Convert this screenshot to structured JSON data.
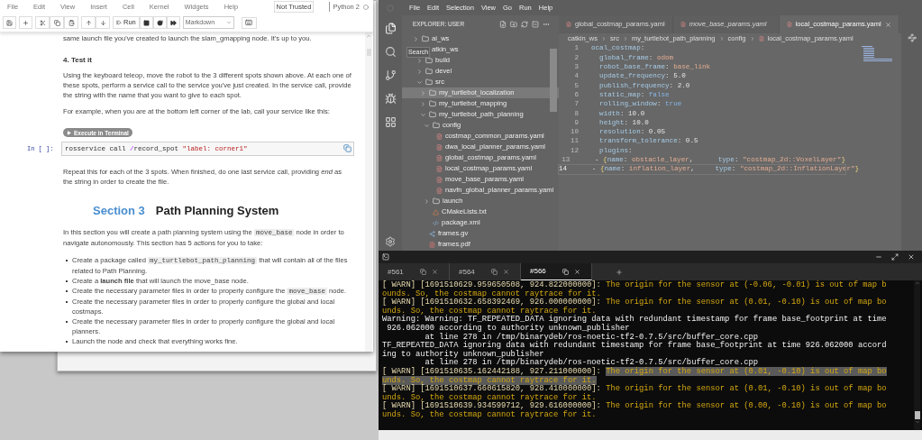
{
  "notebook": {
    "menu": [
      "File",
      "Edit",
      "View",
      "Insert",
      "Cell",
      "Kernel",
      "Widgets",
      "Help"
    ],
    "trust_badge": "Not Trusted",
    "kernel_name": "Python 2",
    "toolbar": {
      "run_label": "Run",
      "cell_type": "Markdown"
    },
    "cells": [
      {
        "kind": "paragraph",
        "segments": [
          {
            "t": "same launch file you've created to launch the slam_gmapping node. It's up to you."
          }
        ]
      },
      {
        "kind": "heading",
        "text": "4. Test it"
      },
      {
        "kind": "paragraph",
        "segments": [
          {
            "t": "Using the keyboard teleop, move the robot to the 3 different spots shown above. At each one of these spots, perform a service call to the service you've just created. In the service call, provide the string with the name that you want to give to each spot."
          }
        ]
      },
      {
        "kind": "paragraph",
        "segments": [
          {
            "t": "For example, when you are at the bottom left corner of the lab, call your service like this:"
          }
        ]
      },
      {
        "kind": "run_button",
        "text": "Execute in Terminal"
      },
      {
        "kind": "code",
        "prompt": "In [ ]:",
        "tokens": [
          {
            "t": "rosservice call ",
            "kind": "plain"
          },
          {
            "t": "/",
            "kind": "op"
          },
          {
            "t": "record_spot ",
            "kind": "plain"
          },
          {
            "t": "\"label: corner1\"",
            "kind": "str"
          }
        ]
      },
      {
        "kind": "paragraph",
        "segments": [
          {
            "t": "Repeat this for each of the 3 spots. When finished, do one last service call, providing *end* as the string in order to create the file."
          }
        ]
      },
      {
        "kind": "section",
        "number": "Section 3",
        "title": "Path Planning System"
      },
      {
        "kind": "paragraph",
        "segments": [
          {
            "t": "In this section you will create a path planning system using the "
          },
          {
            "t": "move_base",
            "kind": "code"
          },
          {
            "t": " node in order to navigate autonomously. This section has 5 actions for you to take:"
          }
        ]
      },
      {
        "kind": "list",
        "items": [
          [
            {
              "t": "Create a package called "
            },
            {
              "t": "my_turtlebot_path_planning",
              "kind": "code"
            },
            {
              "t": " that will contain all of the files related to Path Planning."
            }
          ],
          [
            {
              "t": "Create a **launch file** that will launch the move_base node."
            }
          ],
          [
            {
              "t": "Create the necessary parameter files in order to properly configure the "
            },
            {
              "t": "move_base",
              "kind": "code"
            },
            {
              "t": " node."
            }
          ],
          [
            {
              "t": "Create the necessary parameter files in order to properly configure the global and local costmaps."
            }
          ],
          [
            {
              "t": "Create the necessary parameter files in order to properly configure the global and local planners."
            }
          ],
          [
            {
              "t": "Launch the node and check that everything works fine."
            }
          ]
        ]
      }
    ]
  },
  "vscode": {
    "menu": [
      "File",
      "Edit",
      "Selection",
      "View",
      "Go",
      "Run",
      "Help"
    ],
    "explorer_title": "EXPLORER: USER",
    "tooltip": "Search",
    "tree": [
      {
        "label": "ai_ws",
        "kind": "folder",
        "expanded": false,
        "selected": false
      },
      {
        "label": "atkin_ws",
        "kind": "folder",
        "expanded": true,
        "selected": false,
        "covered": true,
        "children": [
          {
            "label": "build",
            "kind": "folder",
            "expanded": false,
            "selected": false
          },
          {
            "label": "devel",
            "kind": "folder",
            "expanded": false,
            "selected": false
          },
          {
            "label": "src",
            "kind": "folder",
            "expanded": true,
            "selected": false,
            "children": [
              {
                "label": "my_turtlebot_localization",
                "kind": "folder",
                "expanded": false,
                "selected": true
              },
              {
                "label": "my_turtlebot_mapping",
                "kind": "folder",
                "expanded": false,
                "selected": false
              },
              {
                "label": "my_turtlebot_path_planning",
                "kind": "folder",
                "expanded": true,
                "selected": false,
                "children": [
                  {
                    "label": "config",
                    "kind": "folder",
                    "expanded": true,
                    "selected": false,
                    "children": [
                      {
                        "label": "costmap_common_params.yaml",
                        "kind": "yaml",
                        "selected": false
                      },
                      {
                        "label": "dwa_local_planner_params.yaml",
                        "kind": "yaml",
                        "selected": false
                      },
                      {
                        "label": "global_costmap_params.yaml",
                        "kind": "yaml",
                        "selected": false
                      },
                      {
                        "label": "local_costmap_params.yaml",
                        "kind": "yaml",
                        "selected": false
                      },
                      {
                        "label": "move_base_params.yaml",
                        "kind": "yaml",
                        "selected": false
                      },
                      {
                        "label": "navfn_global_planner_params.yaml",
                        "kind": "yaml",
                        "selected": false
                      }
                    ]
                  },
                  {
                    "label": "launch",
                    "kind": "folder",
                    "expanded": false,
                    "selected": false
                  },
                  {
                    "label": "CMakeLists.txt",
                    "kind": "cmake",
                    "selected": false
                  },
                  {
                    "label": "package.xml",
                    "kind": "xml",
                    "selected": false
                  }
                ]
              },
              {
                "label": "frames.gv",
                "kind": "graph",
                "selected": false
              },
              {
                "label": "frames.pdf",
                "kind": "pdf",
                "selected": false
              }
            ]
          }
        ]
      }
    ],
    "tabs": [
      {
        "label": "global_costmap_params.yaml",
        "selected": false,
        "preview": false
      },
      {
        "label": "move_base_params.yaml",
        "selected": false,
        "preview": true
      },
      {
        "label": "local_costmap_params.yaml",
        "selected": true,
        "preview": false
      }
    ],
    "breadcrumbs": [
      "catkin_ws",
      "src",
      "my_turtlebot_path_planning",
      "config",
      "local_costmap_params.yaml"
    ],
    "code_lines": [
      {
        "number": "1",
        "current": false,
        "tokens": [
          {
            "t": "ocal_costmap",
            "kind": "key"
          },
          {
            "t": ":",
            "kind": "punct"
          }
        ]
      },
      {
        "number": "2",
        "current": false,
        "tokens": [
          {
            "t": "  global_frame",
            "kind": "key"
          },
          {
            "t": ": ",
            "kind": "punct"
          },
          {
            "t": "odom",
            "kind": "str"
          }
        ]
      },
      {
        "number": "3",
        "current": false,
        "tokens": [
          {
            "t": "  robot_base_frame",
            "kind": "key"
          },
          {
            "t": ": ",
            "kind": "punct"
          },
          {
            "t": "base_link",
            "kind": "str"
          }
        ]
      },
      {
        "number": "4",
        "current": false,
        "tokens": [
          {
            "t": "  update_frequency",
            "kind": "key"
          },
          {
            "t": ": ",
            "kind": "punct"
          },
          {
            "t": "5.0",
            "kind": "num"
          }
        ]
      },
      {
        "number": "5",
        "current": false,
        "tokens": [
          {
            "t": "  publish_frequency",
            "kind": "key"
          },
          {
            "t": ": ",
            "kind": "punct"
          },
          {
            "t": "2.0",
            "kind": "num"
          }
        ]
      },
      {
        "number": "6",
        "current": false,
        "tokens": [
          {
            "t": "  static_map",
            "kind": "key"
          },
          {
            "t": ": ",
            "kind": "punct"
          },
          {
            "t": "false",
            "kind": "bool"
          }
        ]
      },
      {
        "number": "7",
        "current": false,
        "tokens": [
          {
            "t": "  rolling_window",
            "kind": "key"
          },
          {
            "t": ": ",
            "kind": "punct"
          },
          {
            "t": "true",
            "kind": "bool"
          }
        ]
      },
      {
        "number": "8",
        "current": false,
        "tokens": [
          {
            "t": "  width",
            "kind": "key"
          },
          {
            "t": ": ",
            "kind": "punct"
          },
          {
            "t": "10.0",
            "kind": "num"
          }
        ]
      },
      {
        "number": "9",
        "current": false,
        "tokens": [
          {
            "t": "  height",
            "kind": "key"
          },
          {
            "t": ": ",
            "kind": "punct"
          },
          {
            "t": "10.0",
            "kind": "num"
          }
        ]
      },
      {
        "number": "10",
        "current": false,
        "tokens": [
          {
            "t": "  resolution",
            "kind": "key"
          },
          {
            "t": ": ",
            "kind": "punct"
          },
          {
            "t": "0.05",
            "kind": "num"
          }
        ]
      },
      {
        "number": "11",
        "current": false,
        "tokens": [
          {
            "t": "  transform_tolerance",
            "kind": "key"
          },
          {
            "t": ": ",
            "kind": "punct"
          },
          {
            "t": "0.5",
            "kind": "num"
          }
        ]
      },
      {
        "number": "12",
        "current": false,
        "tokens": [
          {
            "t": "  plugins",
            "kind": "key"
          },
          {
            "t": ":",
            "kind": "punct"
          }
        ]
      },
      {
        "number": "13",
        "current": false,
        "tokens": [
          {
            "t": "   - ",
            "kind": "punct"
          },
          {
            "t": "{",
            "kind": "brace"
          },
          {
            "t": "name",
            "kind": "key"
          },
          {
            "t": ": ",
            "kind": "punct"
          },
          {
            "t": "obstacle_layer",
            "kind": "str"
          },
          {
            "t": ",      ",
            "kind": "punct"
          },
          {
            "t": "type",
            "kind": "key"
          },
          {
            "t": ": ",
            "kind": "punct"
          },
          {
            "t": "\"costmap_2d::VoxelLayer\"",
            "kind": "str"
          },
          {
            "t": "}",
            "kind": "brace"
          }
        ]
      },
      {
        "number": "14",
        "current": true,
        "tokens": [
          {
            "t": "   - ",
            "kind": "punct"
          },
          {
            "t": "{",
            "kind": "brace"
          },
          {
            "t": "name",
            "kind": "key"
          },
          {
            "t": ": ",
            "kind": "punct"
          },
          {
            "t": "inflation_layer",
            "kind": "str"
          },
          {
            "t": ",     ",
            "kind": "punct"
          },
          {
            "t": "type",
            "kind": "key"
          },
          {
            "t": ": ",
            "kind": "punct"
          },
          {
            "t": "\"costmap_2d::InflationLayer\"",
            "kind": "str"
          },
          {
            "t": "}",
            "kind": "brace"
          }
        ]
      }
    ]
  },
  "terminal": {
    "tabs": [
      {
        "label": "#561",
        "selected": false
      },
      {
        "label": "#564",
        "selected": false
      },
      {
        "label": "#566",
        "selected": true
      }
    ],
    "lines": [
      {
        "kind": "warn",
        "highlighted": false,
        "prefix": "[ WARN] [1691510629.959650508, 924.822000000]: ",
        "text": "The origin for the sensor at (-0.06, -0.01) is out of map b"
      },
      {
        "kind": "warn",
        "highlighted": false,
        "text": "ounds. So, the costmap cannot raytrace for it."
      },
      {
        "kind": "warn",
        "highlighted": false,
        "prefix": "[ WARN] [1691510632.658392469, 926.000000000]: ",
        "text": "The origin for the sensor at (0.01, -0.10) is out of map bo"
      },
      {
        "kind": "warn",
        "highlighted": false,
        "text": "unds. So, the costmap cannot raytrace for it."
      },
      {
        "kind": "plain",
        "highlighted": false,
        "text": "Warning: Warning: TF_REPEATED_DATA ignoring data with redundant timestamp for frame base_footprint at time"
      },
      {
        "kind": "plain",
        "highlighted": false,
        "text": " 926.062000 according to authority unknown_publisher"
      },
      {
        "kind": "plain",
        "highlighted": false,
        "text": "         at line 278 in /tmp/binarydeb/ros-noetic-tf2-0.7.5/src/buffer_core.cpp"
      },
      {
        "kind": "plain",
        "highlighted": false,
        "text": "TF_REPEATED_DATA ignoring data with redundant timestamp for frame base_footprint at time 926.062000 accord"
      },
      {
        "kind": "plain",
        "highlighted": false,
        "text": "ing to authority unknown_publisher"
      },
      {
        "kind": "plain",
        "highlighted": false,
        "text": "         at line 278 in /tmp/binarydeb/ros-noetic-tf2-0.7.5/src/buffer_core.cpp"
      },
      {
        "kind": "warn",
        "highlighted": true,
        "prefix": "[ WARN] [1691510635.162442188, 927.211000000]: ",
        "text": "The origin for the sensor at (0.01, -0.10) is out of map bo"
      },
      {
        "kind": "warn",
        "highlighted": true,
        "text": "unds. So, the costmap cannot raytrace for it."
      },
      {
        "kind": "warn",
        "highlighted": false,
        "prefix": "[ WARN] [1691510637.660615820, 928.410000000]: ",
        "text": "The origin for the sensor at (0.01, -0.10) is out of map bo"
      },
      {
        "kind": "warn",
        "highlighted": false,
        "text": "unds. So, the costmap cannot raytrace for it."
      },
      {
        "kind": "warn",
        "highlighted": false,
        "prefix": "[ WARN] [1691510639.934599712, 929.616000000]: ",
        "text": "The origin for the sensor at (0.00, -0.10) is out of map bo"
      },
      {
        "kind": "warn",
        "highlighted": false,
        "text": "unds. So, the costmap cannot raytrace for it."
      }
    ]
  }
}
